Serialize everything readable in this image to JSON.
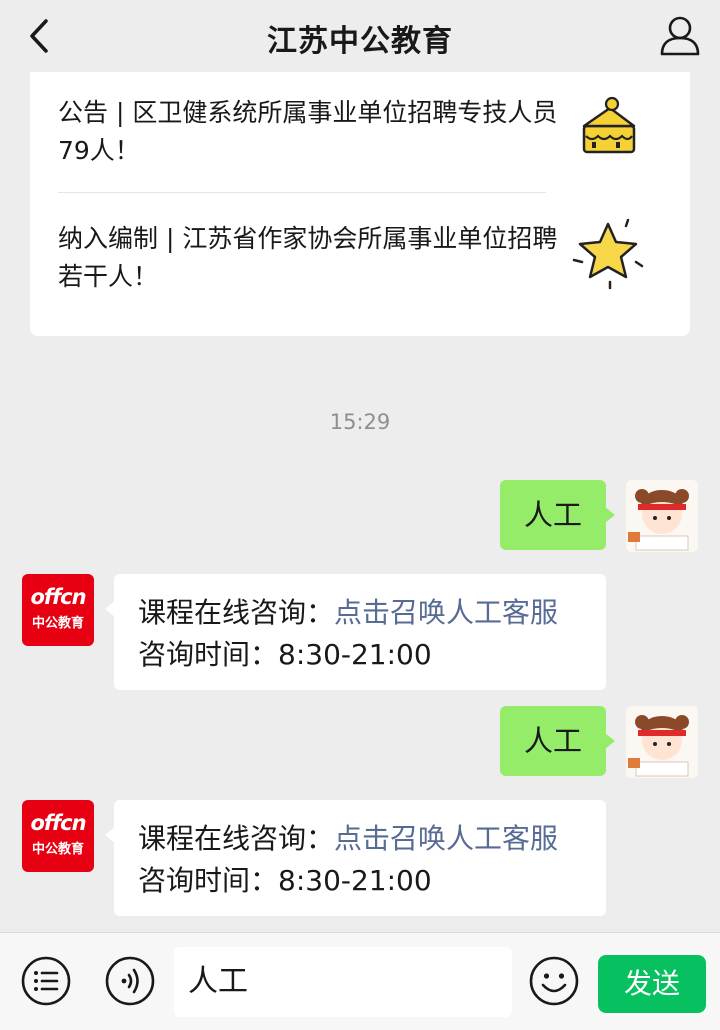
{
  "header": {
    "title": "江苏中公教育"
  },
  "news": [
    {
      "text": "公告 | 区卫健系统所属事业单位招聘专技人员79人！"
    },
    {
      "text": "纳入编制 | 江苏省作家协会所属事业单位招聘若干人！"
    }
  ],
  "timestamp": "15:29",
  "messages": [
    {
      "text": "人工"
    },
    {
      "prefix": "课程在线咨询：",
      "link": "点击召唤人工客服",
      "hours": "咨询时间：8:30-21:00"
    },
    {
      "text": "人工"
    },
    {
      "prefix": "课程在线咨询：",
      "link": "点击召唤人工客服",
      "hours": "咨询时间：8:30-21:00"
    }
  ],
  "brand_avatar": {
    "logo": "offcn",
    "name": "中公教育"
  },
  "input": {
    "value": "人工"
  },
  "send_label": "发送",
  "colors": {
    "bubble_out": "#95ec69",
    "link": "#576b95",
    "send": "#07c160",
    "brand": "#e60012"
  }
}
